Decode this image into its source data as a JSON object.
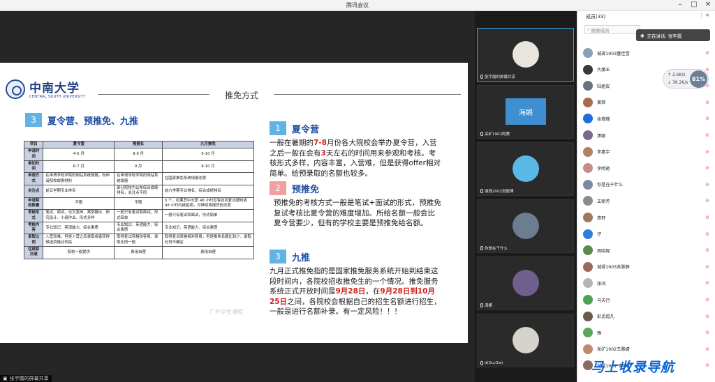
{
  "window": {
    "title": "腾讯会议"
  },
  "share": {
    "label": "张宇霞的屏幕共享"
  },
  "slide": {
    "logo_cn": "中南大学",
    "logo_en": "CENTRAL SOUTH UNIVERSITY",
    "page_title": "推免方式",
    "section_left": {
      "num": "3",
      "title": "夏令营、预推免、九推"
    },
    "table": {
      "headers": [
        "项目",
        "夏令营",
        "预报名",
        "九月推免"
      ],
      "rows": [
        {
          "k": "申请时间",
          "c": [
            "4-6 月",
            "8-9 月",
            "9-10 月"
          ]
        },
        {
          "k": "参加时间",
          "c": [
            "6-7 月",
            "9 月",
            "9-10 月"
          ]
        },
        {
          "k": "申请方式",
          "c": [
            "在申请学校学院的网站系统填报，向申请院校邮寄材料",
            "在申请学校学院的网站系统填报",
            "在国家推免系统填报志愿"
          ]
        },
        {
          "k": "关注点",
          "c": [
            "前五学期专业排名",
            "部分院校为公布综合成绩排名，关注点不同",
            "前六学期专业排名、综合成绩排名"
          ]
        },
        {
          "k": "申请院校数量",
          "c": [
            "不限",
            "不限",
            "3 个，如果其中志愿 48 小时没有收到复试通知或 48 小时内被拒绝，可继续填报其他志愿"
          ]
        },
        {
          "k": "考核形式",
          "c": [
            "笔试、面试、论文答辩、案例展示、研究设计、小组作业、形式多样",
            "一般只有笔试和面试，形式简单",
            "一般只有笔试和面试，形式简单"
          ]
        },
        {
          "k": "考核内容",
          "c": [
            "专业知识、英语能力、综合素质",
            "专业知识、英语能力、综合素质",
            "专业知识、英语能力、综合素质"
          ]
        },
        {
          "k": "录取比例",
          "c": [
            "入营较难，但是入营之后录取或者获得候选资格比例高",
            "取得复试资格较容易，录取比例一般",
            "取得复试资格相对容易，但是推免名额比较少，录取比例不确定"
          ]
        },
        {
          "k": "住宿和交通",
          "c": [
            "院校一般提供",
            "费用自理",
            "费用自理"
          ]
        }
      ]
    },
    "sections": [
      {
        "num": "1",
        "title": "夏令营",
        "text_parts": [
          "一般在暑期的",
          "7-8",
          "月份各大院校会举办夏令营，入营之后一般在会有",
          "3",
          "天左右的时间用来参观和考核。考核形式多样，内容丰富，入营难，但是获得offer相对简单。给预录取的名额也较多。"
        ]
      },
      {
        "num": "2",
        "title": "预推免",
        "text": "预推免的考核方式一般是笔试+面试的形式，预推免复试考核比夏令营的难度增加。所给名额一般会比夏令营要少，但有的学校主要是预推免给名额。"
      },
      {
        "num": "3",
        "title": "九推",
        "text_parts": [
          "九月正式推免指的是国家推免服务系统开始到结束这段时间内，各院校招收推免生的一个情况。推免服务系统正式开放时间是",
          "9月28日",
          "，在",
          "9月28日到10月25日",
          "之间，各院校会根据自己的招生名额进行招生，一般是进行名额补录。有一定风险！！！"
        ]
      }
    ],
    "watermark": "广外学生课程"
  },
  "videos": [
    {
      "name": "张宇霞的屏幕共享",
      "active": true,
      "color": "#e9e4dc",
      "label": ""
    },
    {
      "name": "采矿1902阿腾",
      "active": false,
      "color": "#3d8fd1",
      "label": "海娟"
    },
    {
      "name": "城规2002张毅博",
      "active": false,
      "color": "#5ab8e6",
      "label": ""
    },
    {
      "name": "你是在干什么",
      "active": false,
      "color": "#6c7d92",
      "label": ""
    },
    {
      "name": "潇娜",
      "active": false,
      "color": "#6f5f8c",
      "label": ""
    },
    {
      "name": "d(Ou;Ow)",
      "active": false,
      "color": "#d6d2cc",
      "label": ""
    }
  ],
  "panel": {
    "title": "成员(33)",
    "search_placeholder": "搜索成员",
    "speaking": "正在讲话: 张宇霞",
    "net": {
      "up": "2.6K/s",
      "down": "36.2K/s",
      "gauge": "81%"
    },
    "members": [
      {
        "name": "城规1903董佳雪",
        "color": "#8aa0b8"
      },
      {
        "name": "大魔王",
        "color": "#3a3a3a"
      },
      {
        "name": "陆姐皮",
        "color": "#6b7280"
      },
      {
        "name": "黄琅",
        "color": "#a86b4f"
      },
      {
        "name": "金珊珊",
        "color": "#1e6fd9"
      },
      {
        "name": "潇娜",
        "color": "#7a6a8a"
      },
      {
        "name": "李嘉宇",
        "color": "#b08060"
      },
      {
        "name": "李明艳",
        "color": "#c98a8a"
      },
      {
        "name": "你是在干什么",
        "color": "#7a8aa0"
      },
      {
        "name": "王丽芳",
        "color": "#8c8c8c"
      },
      {
        "name": "悠轩",
        "color": "#a07858"
      },
      {
        "name": "仔",
        "color": "#2f7de0"
      },
      {
        "name": "周晓妮",
        "color": "#5a8a4a"
      },
      {
        "name": "城规1903苏慧静",
        "color": "#9a6a5a"
      },
      {
        "name": "张鸿",
        "color": "#b5b5b5"
      },
      {
        "name": "马天行",
        "color": "#4fa34f"
      },
      {
        "name": "彭孟超凡",
        "color": "#6a5a4a"
      },
      {
        "name": "豫",
        "color": "#5aa85a"
      },
      {
        "name": "采矿1902王雅婧",
        "color": "#c08a6a"
      },
      {
        "name": "城规1901 李明明",
        "color": "#8a6a5a"
      }
    ]
  },
  "brand_watermark": "马上收录导航"
}
